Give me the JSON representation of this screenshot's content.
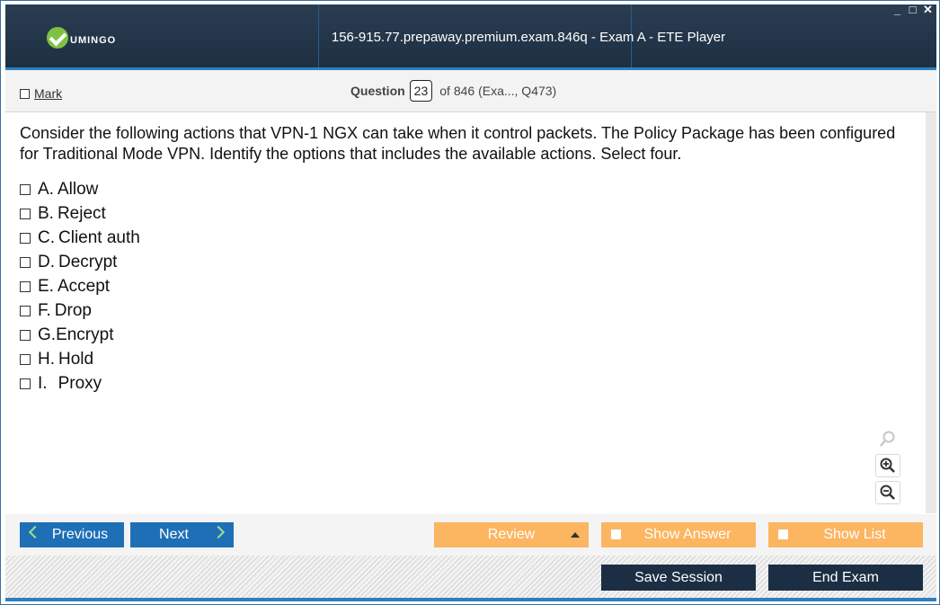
{
  "window": {
    "logo_text": "UMINGO",
    "title": "156-915.77.prepaway.premium.exam.846q - Exam A - ETE Player",
    "controls": [
      "_",
      "□",
      "✕"
    ]
  },
  "header": {
    "mark_label": "Mark",
    "question_label": "Question",
    "question_number": "23",
    "question_total": "of 846 (Exa..., Q473)"
  },
  "question": {
    "stem": "Consider the following actions that VPN-1 NGX can take when it control packets. The Policy Package has been configured for Traditional Mode VPN. Identify the options that includes the available actions. Select four.",
    "options": [
      {
        "letter": "A.",
        "text": "Allow"
      },
      {
        "letter": "B.",
        "text": "Reject"
      },
      {
        "letter": "C.",
        "text": "Client auth"
      },
      {
        "letter": "D.",
        "text": "Decrypt"
      },
      {
        "letter": "E.",
        "text": "Accept"
      },
      {
        "letter": "F.",
        "text": "Drop"
      },
      {
        "letter": "G.",
        "text": "Encrypt"
      },
      {
        "letter": "H.",
        "text": "Hold"
      },
      {
        "letter": "I.",
        "text": "Proxy"
      }
    ]
  },
  "nav": {
    "previous": "Previous",
    "next": "Next",
    "review": "Review",
    "show_answer": "Show Answer",
    "show_list": "Show List"
  },
  "footer": {
    "save_session": "Save Session",
    "end_exam": "End Exam"
  },
  "colors": {
    "title_bar": "#1e2f42",
    "accent_blue": "#1f6fb7",
    "orange": "#fcb560",
    "dark_button": "#1c2e44",
    "logo_green": "#7dc242"
  }
}
